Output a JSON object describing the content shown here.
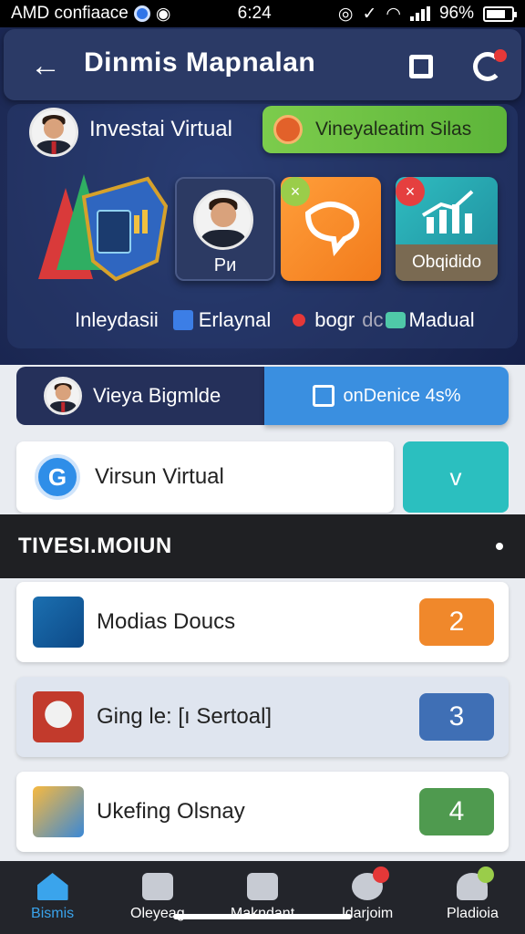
{
  "status_bar": {
    "left_text": "AMD confiaace",
    "time": "6:24",
    "battery": "96%"
  },
  "header": {
    "title": "Dinmis Mapnalan",
    "icons": [
      "back-arrow-icon",
      "square-icon",
      "chat-icon"
    ]
  },
  "hero": {
    "investor_label": "Investai Virtual",
    "green_pill_label": "Vineyaleatim Silas",
    "tile_person_caption": "Ри",
    "tile_teal_caption": "Obqidido",
    "legend": {
      "item1": "Inleydasii",
      "item2": "Erlaynal",
      "item3a": "bogr",
      "item3b": "dc",
      "item3c": "Madual"
    }
  },
  "tabs": {
    "left_label": "Vieya Bigmlde",
    "right_label": "onDenice 4s%"
  },
  "select": {
    "value": "Virsun Virtual",
    "chevron": "v"
  },
  "section": {
    "title": "TIVESI.MOIUN"
  },
  "list": [
    {
      "label": "Modias Doucs",
      "count": "2"
    },
    {
      "label": "Ging le: [ı Sertoal]",
      "count": "3"
    },
    {
      "label": "Ukefing Olsnay",
      "count": "4"
    }
  ],
  "bottom_nav": [
    {
      "label": "Bismis"
    },
    {
      "label": "Oleyeag"
    },
    {
      "label": "Makndant"
    },
    {
      "label": "ldarjoim"
    },
    {
      "label": "Pladioia"
    }
  ],
  "colors": {
    "accent_blue": "#3aa4ec",
    "hero_bg": "#1e2b57",
    "green_pill": "#6ac245",
    "orange": "#f0882b",
    "teal": "#2bbfbf"
  }
}
